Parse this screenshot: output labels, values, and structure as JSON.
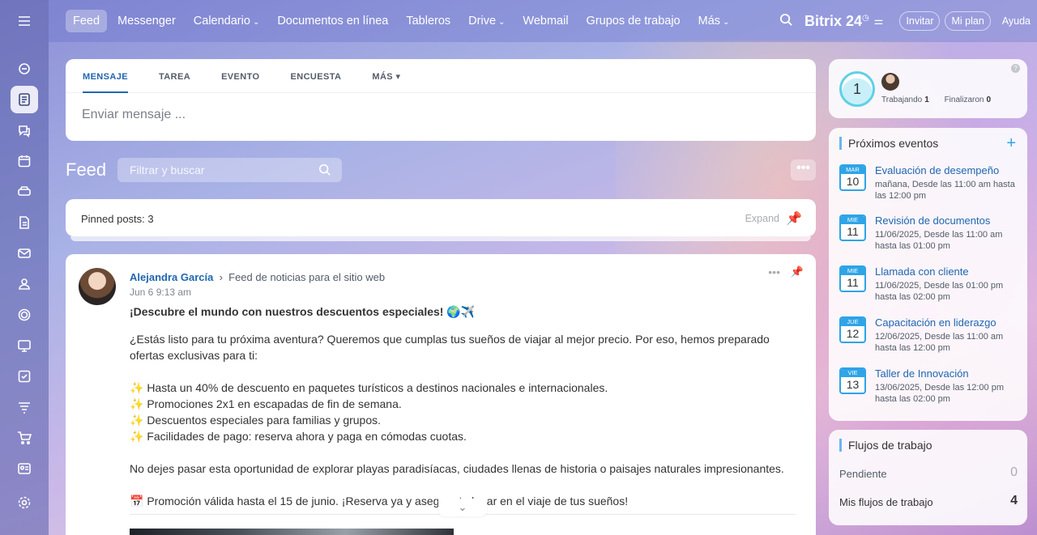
{
  "topnav": {
    "items": [
      {
        "label": "Feed",
        "chevron": false
      },
      {
        "label": "Messenger",
        "chevron": false
      },
      {
        "label": "Calendario",
        "chevron": true
      },
      {
        "label": "Documentos en línea",
        "chevron": false
      },
      {
        "label": "Tableros",
        "chevron": false
      },
      {
        "label": "Drive",
        "chevron": true
      },
      {
        "label": "Webmail",
        "chevron": false
      },
      {
        "label": "Grupos de trabajo",
        "chevron": false
      },
      {
        "label": "Más",
        "chevron": true
      }
    ],
    "brand": "Bitrix 24",
    "invite": "Invitar",
    "plan": "Mi plan",
    "help": "Ayuda"
  },
  "composer": {
    "tabs": [
      "MENSAJE",
      "TAREA",
      "EVENTO",
      "ENCUESTA",
      "MÁS ▾"
    ],
    "placeholder": "Enviar mensaje ..."
  },
  "feed": {
    "title": "Feed",
    "filter_placeholder": "Filtrar y buscar",
    "pinned_label": "Pinned posts:",
    "pinned_count": "3",
    "expand": "Expand"
  },
  "post": {
    "author": "Alejandra García",
    "destination": "Feed de noticias para el sitio web",
    "date": "Jun 6 9:13 am",
    "title": "¡Descubre el mundo con nuestros descuentos especiales! 🌍✈️",
    "intro": "¿Estás listo para tu próxima aventura? Queremos que cumplas tus sueños de viajar al mejor precio. Por eso, hemos preparado ofertas exclusivas para ti:",
    "bullets": [
      "✨ Hasta un 40% de descuento en paquetes turísticos a destinos nacionales e internacionales.",
      "✨ Promociones 2x1 en escapadas de fin de semana.",
      "✨ Descuentos especiales para familias y grupos.",
      "✨ Facilidades de pago: reserva ahora y paga en cómodas cuotas."
    ],
    "closing": "No dejes pasar esta oportunidad de explorar playas paradisíacas, ciudades llenas de historia o paisajes naturales impresionantes.",
    "promo": "📅 Promoción válida hasta el 15 de junio. ¡Reserva ya y asegura tu lugar en el viaje de tus sueños!"
  },
  "timeman": {
    "count": "1",
    "working_label": "Trabajando",
    "working_count": "1",
    "finished_label": "Finalizaron",
    "finished_count": "0"
  },
  "events": {
    "title": "Próximos eventos",
    "items": [
      {
        "mon": "MAR",
        "day": "10",
        "name": "Evaluación de desempeño",
        "when": "mañana, Desde las 11:00 am hasta las 12:00 pm"
      },
      {
        "mon": "MIE",
        "day": "11",
        "name": "Revisión de documentos",
        "when": "11/06/2025, Desde las 11:00 am hasta las 01:00 pm"
      },
      {
        "mon": "MIE",
        "day": "11",
        "name": "Llamada con cliente",
        "when": "11/06/2025, Desde las 01:00 pm hasta las 02:00 pm"
      },
      {
        "mon": "JUE",
        "day": "12",
        "name": "Capacitación en liderazgo",
        "when": "12/06/2025, Desde las 11:00 am hasta las 12:00 pm"
      },
      {
        "mon": "VIE",
        "day": "13",
        "name": "Taller de Innovación",
        "when": "13/06/2025, Desde las 12:00 pm hasta las 02:00 pm"
      }
    ]
  },
  "workflows": {
    "title": "Flujos de trabajo",
    "pending_label": "Pendiente",
    "pending_count": "0",
    "mine_label": "Mis flujos de trabajo",
    "mine_count": "4"
  },
  "colors": {
    "accent": "#2067b0",
    "calendar": "#2fa4e7"
  }
}
